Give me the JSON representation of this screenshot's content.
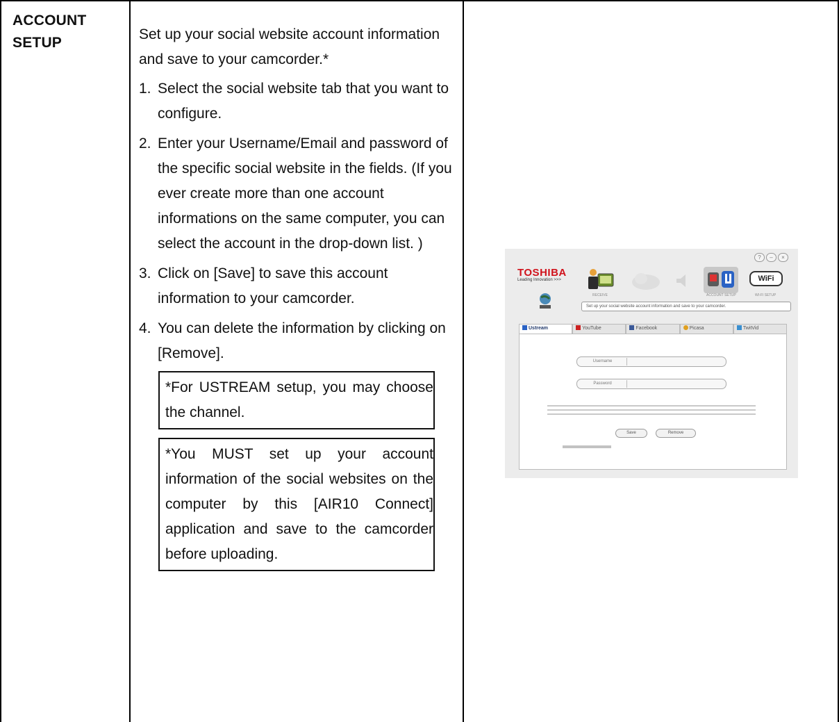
{
  "header": {
    "line1": "ACCOUNT",
    "line2": "SETUP"
  },
  "main": {
    "intro": "Set up your social website account information and save to your camcorder.*",
    "steps": [
      {
        "num": "1.",
        "text": "Select the social website tab that you want to configure."
      },
      {
        "num": "2.",
        "text": "Enter your Username/Email and password of the specific social website in the fields.  (If you ever create more than one account informations on the same computer, you can select the account in the drop-down list. )"
      },
      {
        "num": "3.",
        "text": "Click on [Save] to save this account information to your camcorder."
      },
      {
        "num": "4.",
        "text": "You can delete the information by clicking on [Remove]."
      }
    ],
    "notes": [
      "*For USTREAM setup, you may choose the channel.",
      "*You MUST set up your account information of the social websites on the computer by this [AIR10 Connect] application and save to the camcorder before uploading."
    ]
  },
  "screenshot": {
    "brand": "TOSHIBA",
    "tagline": "Leading Innovation >>>",
    "window_buttons": [
      "?",
      "–",
      "×"
    ],
    "toolbar_labels": [
      "RECEIVE",
      "ACCOUNT SETUP",
      "WI-FI SETUP"
    ],
    "wifi_label": "WiFi",
    "desc": "Set up your social website account information and save to your camcorder.",
    "tabs": [
      {
        "label": "Ustream",
        "color": "#2a62c4"
      },
      {
        "label": "YouTube",
        "color": "#cc2222"
      },
      {
        "label": "Facebook",
        "color": "#3b5998"
      },
      {
        "label": "Picasa",
        "color": "#e0a020"
      },
      {
        "label": "TwitVid",
        "color": "#3a8fd0"
      }
    ],
    "username_label": "Username",
    "password_label": "Password",
    "save_label": "Save",
    "remove_label": "Remove"
  },
  "colors": {
    "brand_red": "#d0121b",
    "border": "#000000"
  }
}
